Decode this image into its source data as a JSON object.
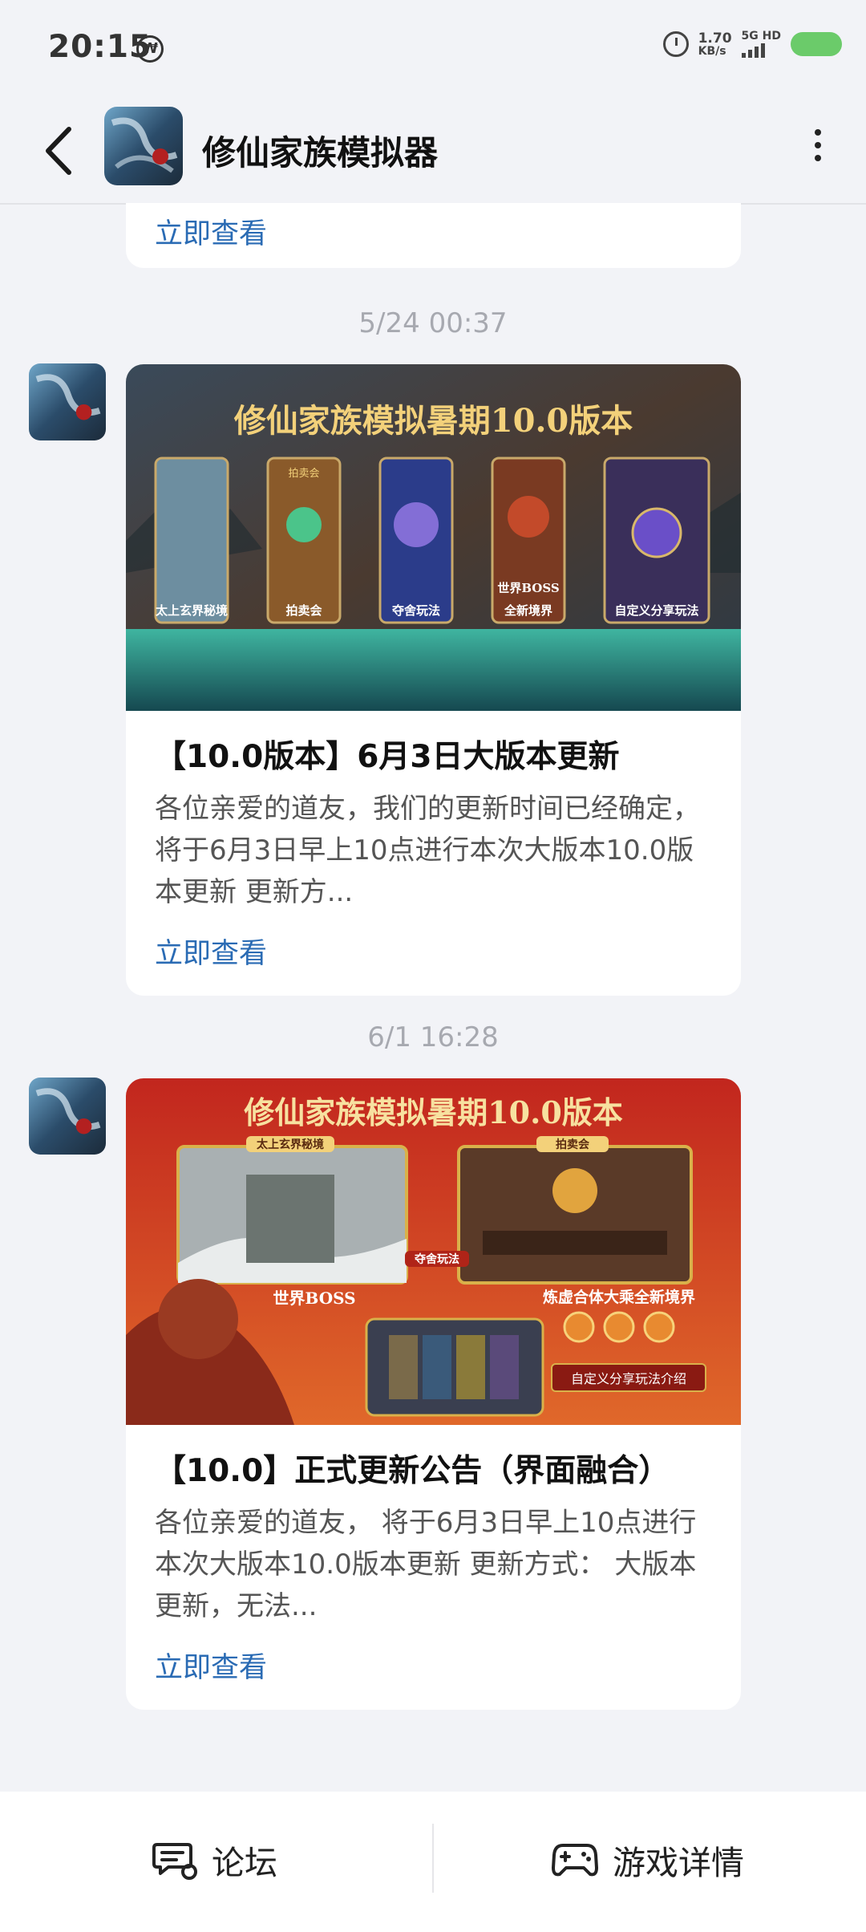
{
  "status_bar": {
    "time": "20:15",
    "speed_value": "1.70",
    "speed_unit": "KB/s",
    "network": "5G HD",
    "icons": [
      "notification-icon",
      "alarm-icon",
      "signal-icon",
      "battery-icon"
    ]
  },
  "header": {
    "title": "修仙家族模拟器",
    "back_icon": "chevron-left-icon",
    "more_icon": "more-vertical-icon"
  },
  "feed": {
    "top_partial_card": {
      "link": "立即查看"
    },
    "posts": [
      {
        "date": "5/24  00:37",
        "banner": {
          "headline": "修仙家族模拟暑期10.0版本",
          "panels": [
            "太上玄界秘境",
            "拍卖会",
            "夺舍玩法",
            "全新境界",
            "自定义分享玩法"
          ],
          "panel_tags": [
            "拍卖会",
            "世界BOSS"
          ]
        },
        "title": "【10.0版本】6月3日大版本更新",
        "desc": "各位亲爱的道友，我们的更新时间已经确定，将于6月3日早上10点进行本次大版本10.0版本更新 更新方...",
        "link": "立即查看"
      },
      {
        "date": "6/1  16:28",
        "banner": {
          "headline": "修仙家族模拟暑期10.0版本",
          "labels": [
            "太上玄界秘境",
            "拍卖会",
            "夺舍玩法",
            "世界BOSS",
            "炼虚合体大乘全新境界",
            "自定义分享玩法介绍"
          ]
        },
        "title": "【10.0】正式更新公告（界面融合）",
        "desc": "各位亲爱的道友， 将于6月3日早上10点进行本次大版本10.0版本更新 更新方式： 大版本更新，无法...",
        "link": "立即查看"
      }
    ]
  },
  "bottom_bar": {
    "forum_label": "论坛",
    "game_label": "游戏详情",
    "forum_icon": "chat-bubble-icon",
    "game_icon": "gamepad-icon"
  },
  "colors": {
    "link": "#2a6bb4",
    "background": "#f2f3f7",
    "card": "#ffffff",
    "date": "#a7a9b0"
  }
}
